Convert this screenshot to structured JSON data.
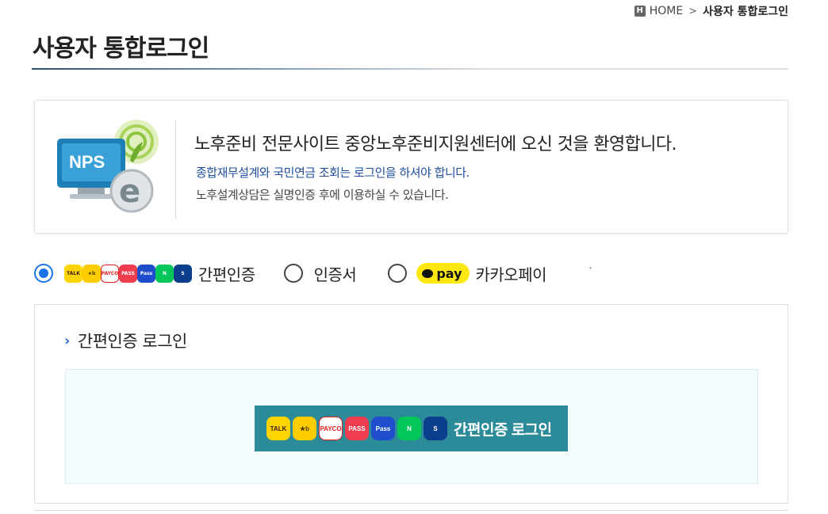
{
  "breadcrumb": {
    "home_label": "HOME",
    "current": "사용자 통합로그인",
    "home_icon": "home-icon"
  },
  "page": {
    "title": "사용자 통합로그인"
  },
  "welcome": {
    "logo_text": "NPS",
    "main": "노후준비 전문사이트 중앙노후준비지원센터에 오신 것을 환영합니다.",
    "sub1": "종합재무설계와 국민연금 조회는 로그인을 하셔야 합니다.",
    "sub2": "노후설계상담은 실명인증 후에 이용하실 수 있습니다."
  },
  "auth_options": {
    "selected": "simple",
    "simple_label": "간편인증",
    "cert_label": "인증서",
    "kakaopay_badge": "pay",
    "kakaopay_label": "카카오페이",
    "stray_mark": "`"
  },
  "provider_icons": [
    {
      "name": "kakaotalk-icon",
      "text": "TALK",
      "bg": "#ffd400",
      "fg": "#3a1d1d"
    },
    {
      "name": "kb-icon",
      "text": "★b",
      "bg": "#ffcc00",
      "fg": "#4a3a00"
    },
    {
      "name": "payco-icon",
      "text": "PAYCO",
      "bg": "#ffffff",
      "fg": "#e02020"
    },
    {
      "name": "pass-icon",
      "text": "PASS",
      "bg": "#ee3d4f",
      "fg": "#ffffff"
    },
    {
      "name": "samsung-pass-icon",
      "text": "Pass",
      "bg": "#1e4ecb",
      "fg": "#ffffff"
    },
    {
      "name": "naver-icon",
      "text": "N",
      "bg": "#03c75a",
      "fg": "#ffffff"
    },
    {
      "name": "shinhan-icon",
      "text": "S",
      "bg": "#0b3e8c",
      "fg": "#ffffff"
    }
  ],
  "login_section": {
    "title": "간편인증 로그인",
    "button_label": "간편인증 로그인"
  },
  "colors": {
    "accent": "#1a73e8",
    "button_bg": "#2c8b99",
    "kakao_yellow": "#ffe812",
    "link_blue": "#1f4e9c"
  }
}
